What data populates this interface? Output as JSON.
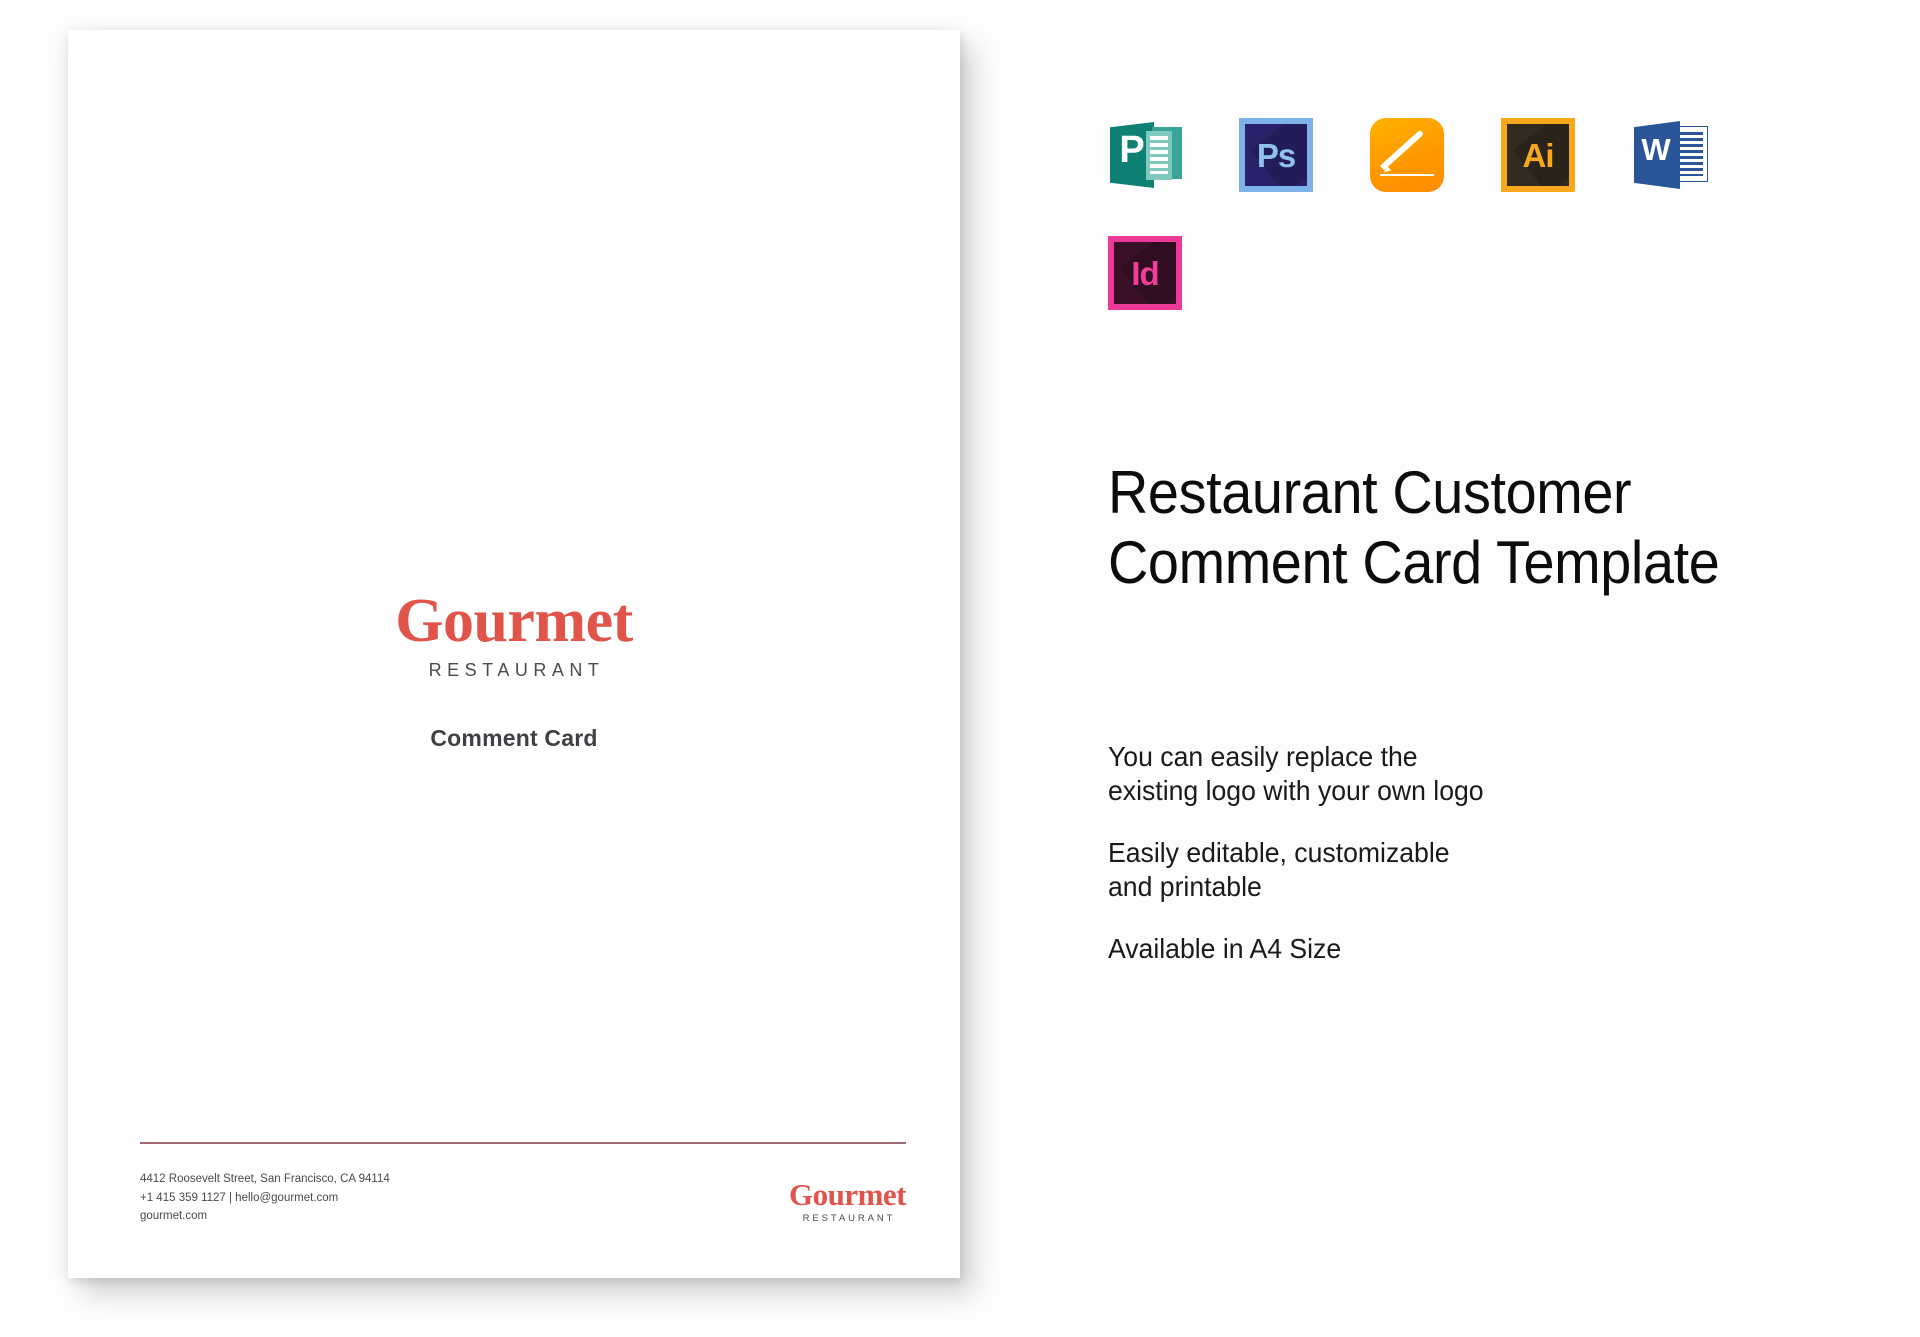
{
  "product": {
    "title": "Restaurant Customer Comment Card Template",
    "features": [
      "You can easily replace the\nexisting logo with your own logo",
      "Easily editable, customizable\nand printable",
      "Available in A4 Size"
    ]
  },
  "formats": [
    {
      "name": "microsoft-publisher",
      "glyph": "P",
      "label": "Publisher"
    },
    {
      "name": "adobe-photoshop",
      "glyph": "Ps",
      "label": "Photoshop"
    },
    {
      "name": "apple-pages",
      "glyph": "",
      "label": "Pages"
    },
    {
      "name": "adobe-illustrator",
      "glyph": "Ai",
      "label": "Illustrator"
    },
    {
      "name": "microsoft-word",
      "glyph": "W",
      "label": "Word"
    },
    {
      "name": "adobe-indesign",
      "glyph": "Id",
      "label": "InDesign"
    }
  ],
  "card": {
    "logo": {
      "word": "Gourmet",
      "sub": "RESTAURANT"
    },
    "subtitle": "Comment Card",
    "footer": {
      "address": "4412 Roosevelt Street, San Francisco, CA 94114",
      "contact": "+1 415 359 1127 | hello@gourmet.com",
      "website": "gourmet.com",
      "logo": {
        "word": "Gourmet",
        "sub": "RESTAURANT"
      }
    }
  },
  "colors": {
    "brand_red": "#e0544a",
    "rule": "#9e6a72",
    "text_dark": "#1a1a1a",
    "text_muted": "#4a4a4f",
    "publisher": "#0f8074",
    "photoshop": "#29226b",
    "photoshop_border": "#7fb2e8",
    "pages": "#ff9800",
    "illustrator": "#f7a81b",
    "word": "#2a5699",
    "indesign": "#ec3a96"
  }
}
